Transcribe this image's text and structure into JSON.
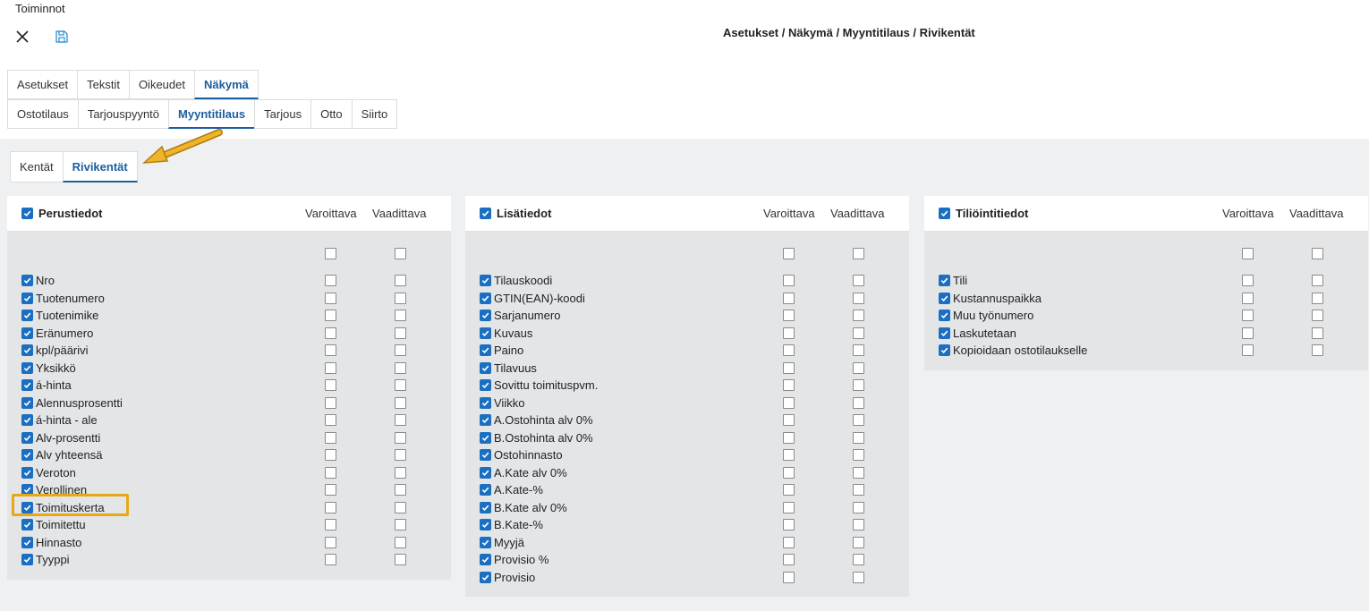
{
  "header": {
    "app_title": "Toiminnot",
    "breadcrumb": "Asetukset / Näkymä / Myyntitilaus / Rivikentät",
    "close_icon": "close-icon",
    "save_icon": "save-icon"
  },
  "tabs_row1": [
    {
      "label": "Asetukset",
      "active": false
    },
    {
      "label": "Tekstit",
      "active": false
    },
    {
      "label": "Oikeudet",
      "active": false
    },
    {
      "label": "Näkymä",
      "active": true
    }
  ],
  "tabs_row2": [
    {
      "label": "Ostotilaus",
      "active": false
    },
    {
      "label": "Tarjouspyyntö",
      "active": false
    },
    {
      "label": "Myyntitilaus",
      "active": true
    },
    {
      "label": "Tarjous",
      "active": false
    },
    {
      "label": "Otto",
      "active": false
    },
    {
      "label": "Siirto",
      "active": false
    }
  ],
  "subtabs": [
    {
      "label": "Kentät",
      "active": false
    },
    {
      "label": "Rivikentät",
      "active": true
    }
  ],
  "columns": {
    "warning": "Varoittava",
    "required": "Vaadittava"
  },
  "colors": {
    "accent": "#1b6fc2",
    "highlight": "#e6a817"
  },
  "panels": [
    {
      "title": "Perustiedot",
      "items": [
        "Nro",
        "Tuotenumero",
        "Tuotenimike",
        "Eränumero",
        "kpl/päärivi",
        "Yksikkö",
        "á-hinta",
        "Alennusprosentti",
        "á-hinta - ale",
        "Alv-prosentti",
        "Alv yhteensä",
        "Veroton",
        "Verollinen",
        "Toimituskerta",
        "Toimitettu",
        "Hinnasto",
        "Tyyppi"
      ]
    },
    {
      "title": "Lisätiedot",
      "items": [
        "Tilauskoodi",
        "GTIN(EAN)-koodi",
        "Sarjanumero",
        "Kuvaus",
        "Paino",
        "Tilavuus",
        "Sovittu toimituspvm.",
        "Viikko",
        "A.Ostohinta alv 0%",
        "B.Ostohinta alv 0%",
        "Ostohinnasto",
        "A.Kate alv 0%",
        "A.Kate-%",
        "B.Kate alv 0%",
        "B.Kate-%",
        "Myyjä",
        "Provisio %",
        "Provisio"
      ]
    },
    {
      "title": "Tiliöintitiedot",
      "items": [
        "Tili",
        "Kustannuspaikka",
        "Muu työnumero",
        "Laskutetaan",
        "Kopioidaan ostotilaukselle"
      ]
    }
  ]
}
